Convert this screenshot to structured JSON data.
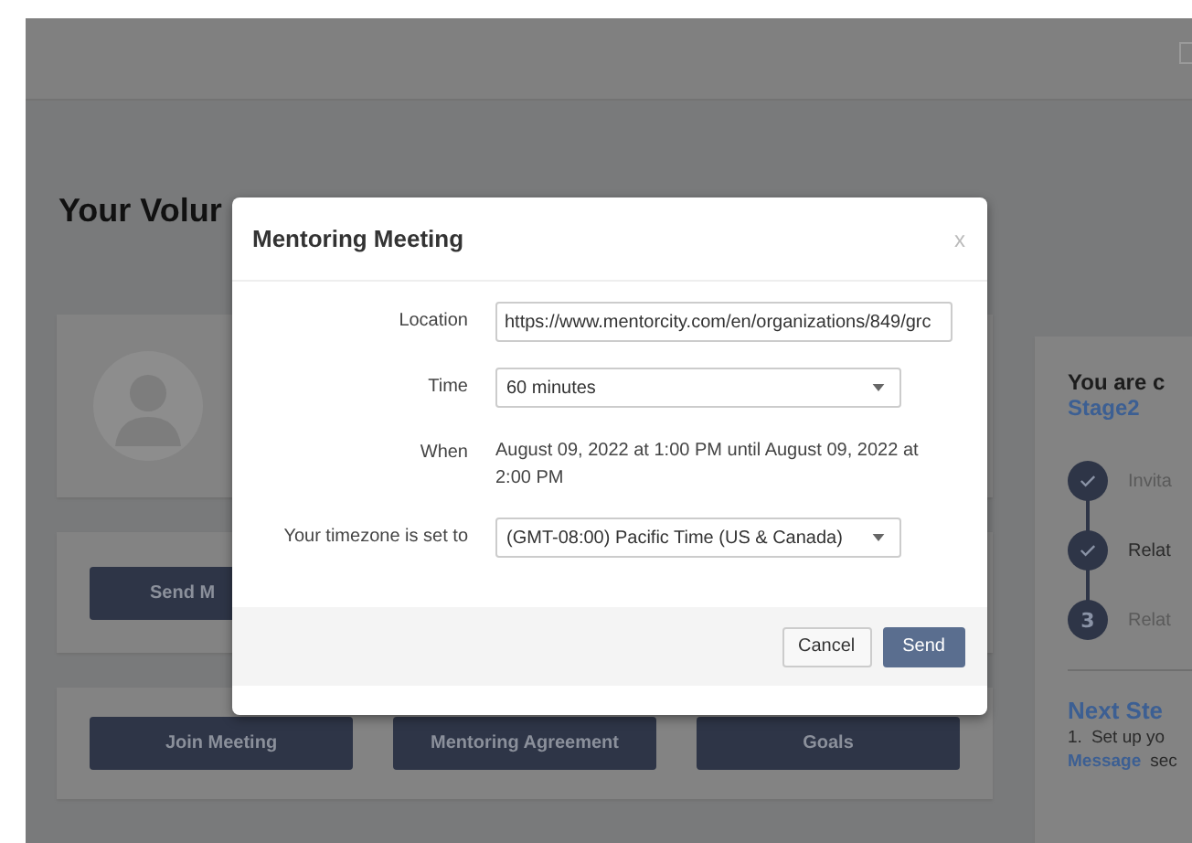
{
  "page": {
    "title": "Your Volur"
  },
  "profile_card": {
    "actions": [
      {
        "label": "Send M"
      }
    ]
  },
  "action_buttons": [
    {
      "label": "Join Meeting"
    },
    {
      "label": "Mentoring Agreement"
    },
    {
      "label": "Goals"
    }
  ],
  "stage_panel": {
    "heading": "You are c",
    "stage": "Stage2",
    "steps": [
      {
        "label": "Invita",
        "completed": true,
        "current": false
      },
      {
        "label": "Relat",
        "completed": true,
        "current": true
      },
      {
        "marker": "3",
        "label": "Relat",
        "completed": false,
        "current": false
      }
    ],
    "next_steps_title": "Next Ste",
    "next_steps": [
      {
        "number": "1.",
        "text": "Set up yo"
      }
    ],
    "next_steps_link": "Message",
    "next_steps_tail": "sec"
  },
  "dialog": {
    "title": "Mentoring Meeting",
    "close": "x",
    "fields": [
      {
        "kind": "input",
        "label": "Location",
        "value": "https://www.mentorcity.com/en/organizations/849/grc"
      },
      {
        "kind": "select",
        "label": "Time",
        "value": "60 minutes"
      },
      {
        "kind": "text",
        "label": "When",
        "value": "August 09, 2022 at 1:00 PM until August 09, 2022 at 2:00 PM"
      },
      {
        "kind": "select",
        "label": "Your timezone is set to",
        "value": "(GMT-08:00) Pacific Time (US & Canada)"
      }
    ],
    "buttons": [
      {
        "label": "Cancel",
        "primary": false
      },
      {
        "label": "Send",
        "primary": true
      }
    ]
  }
}
